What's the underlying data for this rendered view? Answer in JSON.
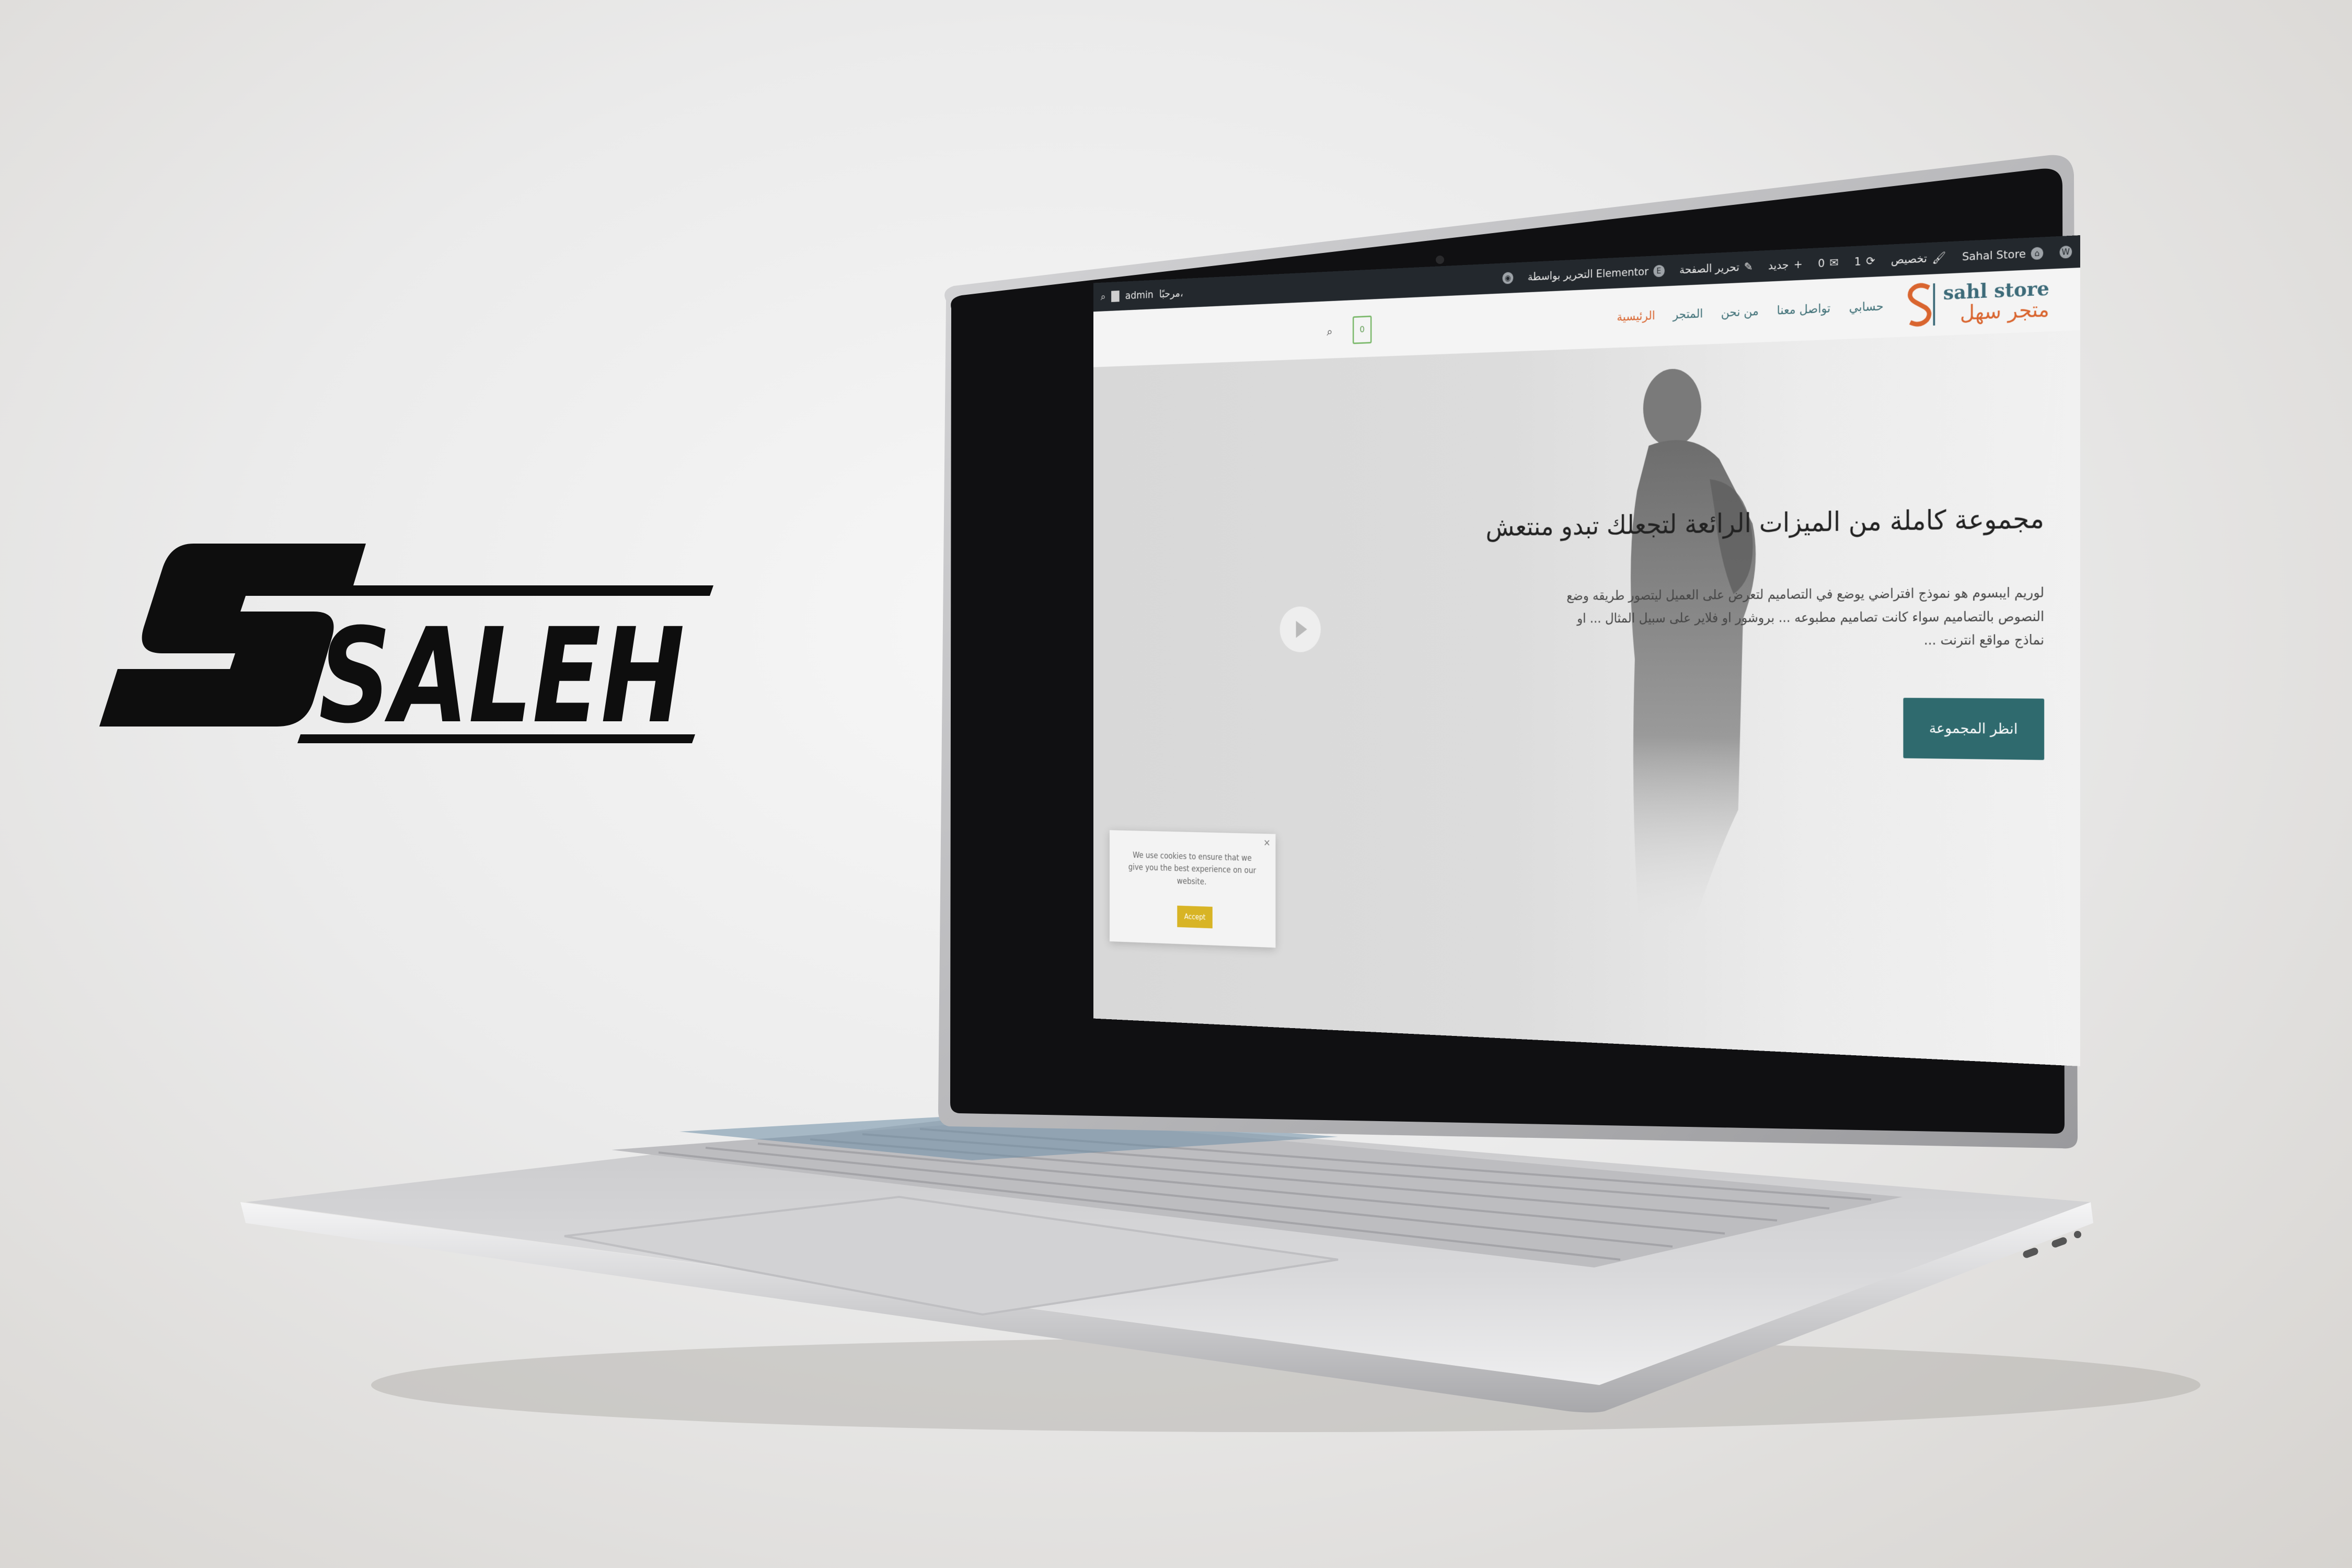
{
  "brand_logo": {
    "text": "SALEH",
    "letter": "S"
  },
  "admin_bar": {
    "site_name": "Sahal Store",
    "customize": "تخصيص",
    "updates_count": "1",
    "comments_count": "0",
    "new_label": "جديد",
    "edit_page": "تحرير الصفحة",
    "edit_with_elementor": "التحرير بواسطة Elementor",
    "greeting": "مرحبًا،",
    "user": "admin"
  },
  "header": {
    "logo_en": "sahl store",
    "logo_ar": "متجر سهل",
    "nav": [
      "الرئيسية",
      "المتجر",
      "من نحن",
      "تواصل معنا",
      "حسابي"
    ],
    "cart_count": "0"
  },
  "hero": {
    "title": "مجموعة كاملة من الميزات الرائعة لتجعلك تبدو منتعش",
    "text": "لوريم ايبسوم هو نموذج افتراضي يوضع في التصاميم لتعرض على العميل ليتصور طريقه وضع النصوص بالتصاميم سواء كانت تصاميم مطبوعه ... بروشور او فلاير على سبيل المثال ... او نماذج مواقع انترنت ...",
    "cta": "انظر المجموعة"
  },
  "cookie": {
    "message": "We use cookies to ensure that we give you the best experience on our website.",
    "accept": "Accept",
    "close": "×"
  },
  "colors": {
    "accent_teal": "#2f6a6e",
    "accent_orange": "#d9652f",
    "cookie_button": "#d8b425",
    "admin_bar": "#23282d"
  }
}
